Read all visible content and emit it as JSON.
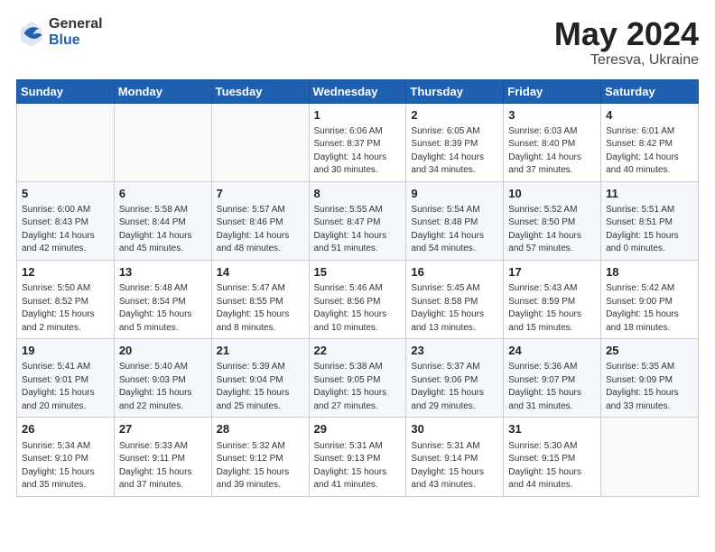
{
  "logo": {
    "general": "General",
    "blue": "Blue"
  },
  "title": {
    "month_year": "May 2024",
    "location": "Teresva, Ukraine"
  },
  "weekdays": [
    "Sunday",
    "Monday",
    "Tuesday",
    "Wednesday",
    "Thursday",
    "Friday",
    "Saturday"
  ],
  "weeks": [
    [
      {
        "day": "",
        "info": ""
      },
      {
        "day": "",
        "info": ""
      },
      {
        "day": "",
        "info": ""
      },
      {
        "day": "1",
        "info": "Sunrise: 6:06 AM\nSunset: 8:37 PM\nDaylight: 14 hours\nand 30 minutes."
      },
      {
        "day": "2",
        "info": "Sunrise: 6:05 AM\nSunset: 8:39 PM\nDaylight: 14 hours\nand 34 minutes."
      },
      {
        "day": "3",
        "info": "Sunrise: 6:03 AM\nSunset: 8:40 PM\nDaylight: 14 hours\nand 37 minutes."
      },
      {
        "day": "4",
        "info": "Sunrise: 6:01 AM\nSunset: 8:42 PM\nDaylight: 14 hours\nand 40 minutes."
      }
    ],
    [
      {
        "day": "5",
        "info": "Sunrise: 6:00 AM\nSunset: 8:43 PM\nDaylight: 14 hours\nand 42 minutes."
      },
      {
        "day": "6",
        "info": "Sunrise: 5:58 AM\nSunset: 8:44 PM\nDaylight: 14 hours\nand 45 minutes."
      },
      {
        "day": "7",
        "info": "Sunrise: 5:57 AM\nSunset: 8:46 PM\nDaylight: 14 hours\nand 48 minutes."
      },
      {
        "day": "8",
        "info": "Sunrise: 5:55 AM\nSunset: 8:47 PM\nDaylight: 14 hours\nand 51 minutes."
      },
      {
        "day": "9",
        "info": "Sunrise: 5:54 AM\nSunset: 8:48 PM\nDaylight: 14 hours\nand 54 minutes."
      },
      {
        "day": "10",
        "info": "Sunrise: 5:52 AM\nSunset: 8:50 PM\nDaylight: 14 hours\nand 57 minutes."
      },
      {
        "day": "11",
        "info": "Sunrise: 5:51 AM\nSunset: 8:51 PM\nDaylight: 15 hours\nand 0 minutes."
      }
    ],
    [
      {
        "day": "12",
        "info": "Sunrise: 5:50 AM\nSunset: 8:52 PM\nDaylight: 15 hours\nand 2 minutes."
      },
      {
        "day": "13",
        "info": "Sunrise: 5:48 AM\nSunset: 8:54 PM\nDaylight: 15 hours\nand 5 minutes."
      },
      {
        "day": "14",
        "info": "Sunrise: 5:47 AM\nSunset: 8:55 PM\nDaylight: 15 hours\nand 8 minutes."
      },
      {
        "day": "15",
        "info": "Sunrise: 5:46 AM\nSunset: 8:56 PM\nDaylight: 15 hours\nand 10 minutes."
      },
      {
        "day": "16",
        "info": "Sunrise: 5:45 AM\nSunset: 8:58 PM\nDaylight: 15 hours\nand 13 minutes."
      },
      {
        "day": "17",
        "info": "Sunrise: 5:43 AM\nSunset: 8:59 PM\nDaylight: 15 hours\nand 15 minutes."
      },
      {
        "day": "18",
        "info": "Sunrise: 5:42 AM\nSunset: 9:00 PM\nDaylight: 15 hours\nand 18 minutes."
      }
    ],
    [
      {
        "day": "19",
        "info": "Sunrise: 5:41 AM\nSunset: 9:01 PM\nDaylight: 15 hours\nand 20 minutes."
      },
      {
        "day": "20",
        "info": "Sunrise: 5:40 AM\nSunset: 9:03 PM\nDaylight: 15 hours\nand 22 minutes."
      },
      {
        "day": "21",
        "info": "Sunrise: 5:39 AM\nSunset: 9:04 PM\nDaylight: 15 hours\nand 25 minutes."
      },
      {
        "day": "22",
        "info": "Sunrise: 5:38 AM\nSunset: 9:05 PM\nDaylight: 15 hours\nand 27 minutes."
      },
      {
        "day": "23",
        "info": "Sunrise: 5:37 AM\nSunset: 9:06 PM\nDaylight: 15 hours\nand 29 minutes."
      },
      {
        "day": "24",
        "info": "Sunrise: 5:36 AM\nSunset: 9:07 PM\nDaylight: 15 hours\nand 31 minutes."
      },
      {
        "day": "25",
        "info": "Sunrise: 5:35 AM\nSunset: 9:09 PM\nDaylight: 15 hours\nand 33 minutes."
      }
    ],
    [
      {
        "day": "26",
        "info": "Sunrise: 5:34 AM\nSunset: 9:10 PM\nDaylight: 15 hours\nand 35 minutes."
      },
      {
        "day": "27",
        "info": "Sunrise: 5:33 AM\nSunset: 9:11 PM\nDaylight: 15 hours\nand 37 minutes."
      },
      {
        "day": "28",
        "info": "Sunrise: 5:32 AM\nSunset: 9:12 PM\nDaylight: 15 hours\nand 39 minutes."
      },
      {
        "day": "29",
        "info": "Sunrise: 5:31 AM\nSunset: 9:13 PM\nDaylight: 15 hours\nand 41 minutes."
      },
      {
        "day": "30",
        "info": "Sunrise: 5:31 AM\nSunset: 9:14 PM\nDaylight: 15 hours\nand 43 minutes."
      },
      {
        "day": "31",
        "info": "Sunrise: 5:30 AM\nSunset: 9:15 PM\nDaylight: 15 hours\nand 44 minutes."
      },
      {
        "day": "",
        "info": ""
      }
    ]
  ]
}
